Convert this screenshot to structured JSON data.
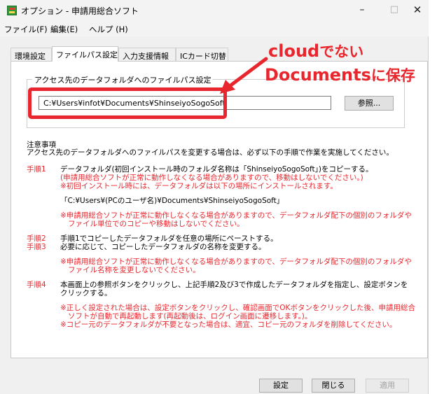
{
  "window": {
    "title": "オプション - 申請用総合ソフト",
    "controls": {
      "minimize": "–",
      "maximize": "□",
      "close": "✕"
    }
  },
  "menu": [
    "ファイル(F)",
    "編集(E)",
    "ヘルプ (H)"
  ],
  "tabs": [
    "環境設定",
    "ファイルパス設定",
    "入力支援情報",
    "ICカード切替"
  ],
  "active_tab": "ファイルパス設定",
  "group": {
    "label": "アクセス先のデータフォルダへのファイルパス設定",
    "path_value": "C:¥Users¥infot¥Documents¥ShinseiyoSogoSoft",
    "browse_label": "参照..."
  },
  "annotation": {
    "line1_a": "cloud",
    "line1_b": "でない",
    "line2_a": "Documents",
    "line2_b": "に保存",
    "color": "#e8262d"
  },
  "notes": {
    "heading": "注意事項",
    "intro": "アクセス先のデータフォルダへのファイルパスを変更する場合は、必ず以下の手順で作業を実施してください。",
    "step1_label": "手順1",
    "step1_text": "データフォルダ(初回インストール時のフォルダ名称は「ShinseiyoSogoSoft」)をコピーする。",
    "step1_red1": "(申請用総合ソフトが正常に動作しなくなる場合がありますので、移動はしないでください。)",
    "step1_red2": "※初回インストール時には、データフォルダは以下の場所にインストールされます。",
    "step1_path": "「C:¥Users¥(PCのユーザ名)¥Documents¥ShinseiyoSogoSoft」",
    "step1_warn1": "※申請用総合ソフトが正常に動作しなくなる場合がありますので、データフォルダ配下の個別のフォルダや",
    "step1_warn2": "ファイル単位でのコピーや移動はしないでください。",
    "step2_label": "手順2",
    "step2_text": "手順1でコピーしたデータフォルダを任意の場所にペーストする。",
    "step3_label": "手順3",
    "step3_text": "必要に応じて、コピーしたデータフォルダの名称を変更する。",
    "step3_warn1": "※申請用総合ソフトが正常に動作しなくなる場合がありますので、データフォルダ配下の個別のフォルダや",
    "step3_warn2": "ファイル名称を変更しないでください。",
    "step4_label": "手順4",
    "step4_text1": "本画面上の参照ボタンをクリックし、上記手順2及び3で作成したデータフォルダを指定し、設定ボタンを",
    "step4_text2": "クリックする。",
    "step4_red1": "※正しく設定された場合は、設定ボタンをクリックし、確認画面でOKボタンをクリックした後、申請用総合",
    "step4_red2": "ソフトが自動で再起動します(再起動後は、ログイン画面に遷移します。)。",
    "step4_red3": "※コピー元のデータフォルダが不要となった場合は、適宜、コピー元のフォルダを削除してください。"
  },
  "buttons": {
    "ok": "設定",
    "close": "閉じる",
    "apply": "適用"
  }
}
